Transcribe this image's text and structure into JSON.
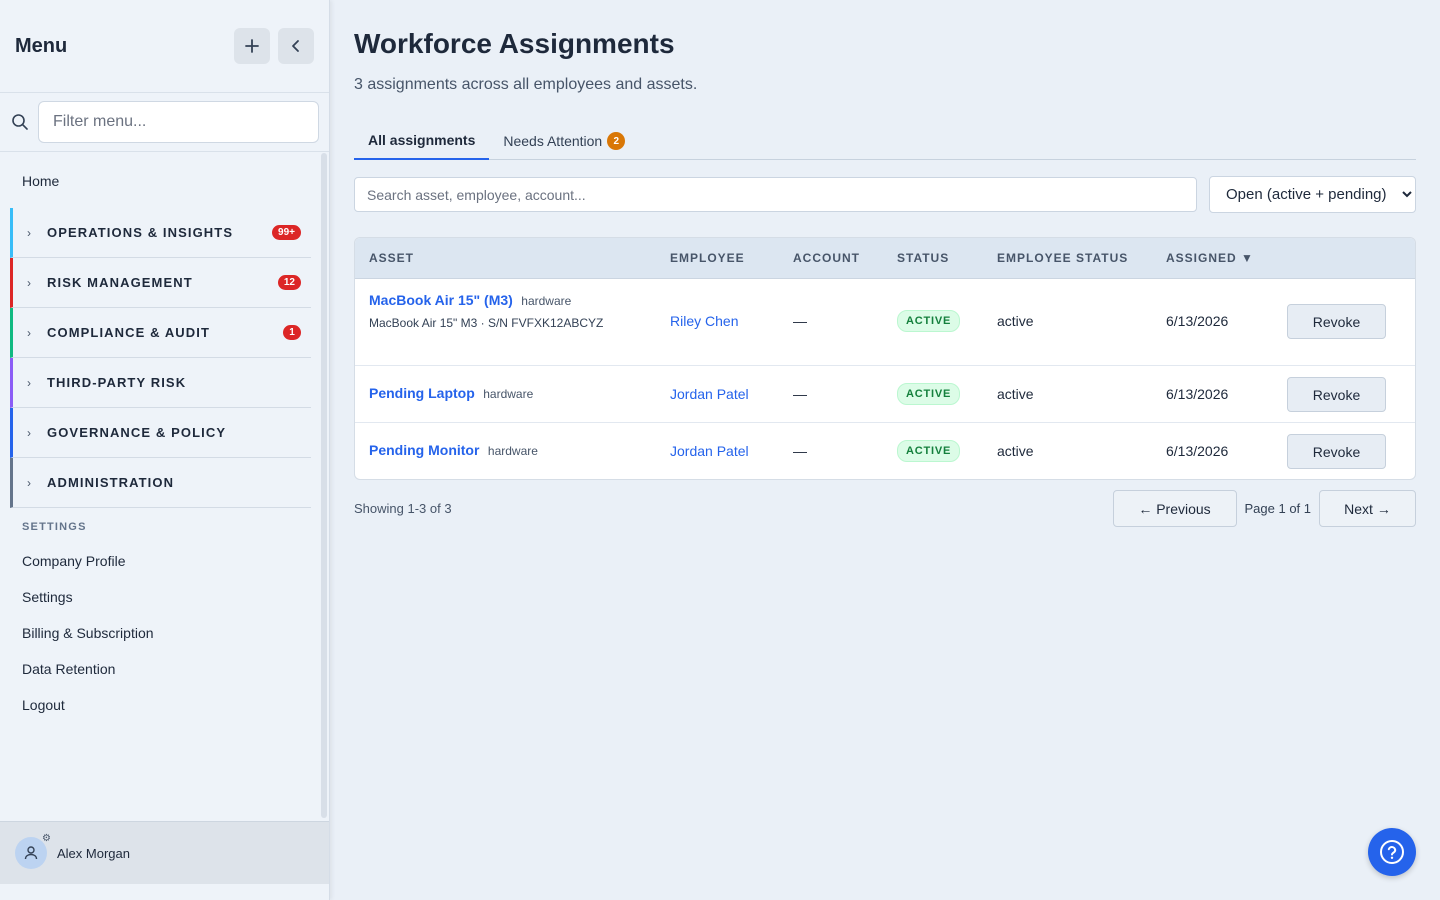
{
  "sidebar": {
    "title": "Menu",
    "filter_placeholder": "Filter menu...",
    "home": "Home",
    "groups": [
      {
        "label": "OPERATIONS & INSIGHTS",
        "badge": "99+",
        "color": "#38bdf8"
      },
      {
        "label": "RISK MANAGEMENT",
        "badge": "12",
        "color": "#dc2626"
      },
      {
        "label": "COMPLIANCE & AUDIT",
        "badge": "1",
        "color": "#10b981"
      },
      {
        "label": "THIRD-PARTY RISK",
        "badge": "",
        "color": "#8b5cf6"
      },
      {
        "label": "GOVERNANCE & POLICY",
        "badge": "",
        "color": "#2563eb"
      },
      {
        "label": "ADMINISTRATION",
        "badge": "",
        "color": "#64748b"
      }
    ],
    "settings_section": "SETTINGS",
    "settings_links": [
      "Company Profile",
      "Settings",
      "Billing & Subscription",
      "Data Retention",
      "Logout"
    ],
    "user_name": "Alex Morgan"
  },
  "main": {
    "title": "Workforce Assignments",
    "subtitle": "3 assignments across all employees and assets.",
    "tabs": [
      {
        "label": "All assignments"
      },
      {
        "label": "Needs Attention",
        "badge": "2"
      }
    ],
    "search_placeholder": "Search asset, employee, account...",
    "filter_selected": "Open (active + pending)",
    "columns": [
      "ASSET",
      "EMPLOYEE",
      "ACCOUNT",
      "STATUS",
      "EMPLOYEE STATUS",
      "ASSIGNED ▼"
    ],
    "rows": [
      {
        "asset": "MacBook Air 15\" (M3)",
        "type": "hardware",
        "detail": "MacBook Air 15\" M3 · S/N FVFXK12ABCYZ",
        "employee": "Riley Chen",
        "account": "—",
        "status": "ACTIVE",
        "employee_status": "active",
        "assigned": "6/13/2026",
        "action": "Revoke"
      },
      {
        "asset": "Pending Laptop",
        "type": "hardware",
        "detail": "",
        "employee": "Jordan Patel",
        "account": "—",
        "status": "ACTIVE",
        "employee_status": "active",
        "assigned": "6/13/2026",
        "action": "Revoke"
      },
      {
        "asset": "Pending Monitor",
        "type": "hardware",
        "detail": "",
        "employee": "Jordan Patel",
        "account": "—",
        "status": "ACTIVE",
        "employee_status": "active",
        "assigned": "6/13/2026",
        "action": "Revoke"
      }
    ],
    "showing": "Showing 1-3 of 3",
    "prev_label": "← Previous",
    "page_info": "Page 1 of 1",
    "next_label": "Next →"
  },
  "icons": {
    "add": "plus-icon",
    "collapse": "chevron-left-icon",
    "search": "search-icon",
    "help": "help-icon"
  }
}
